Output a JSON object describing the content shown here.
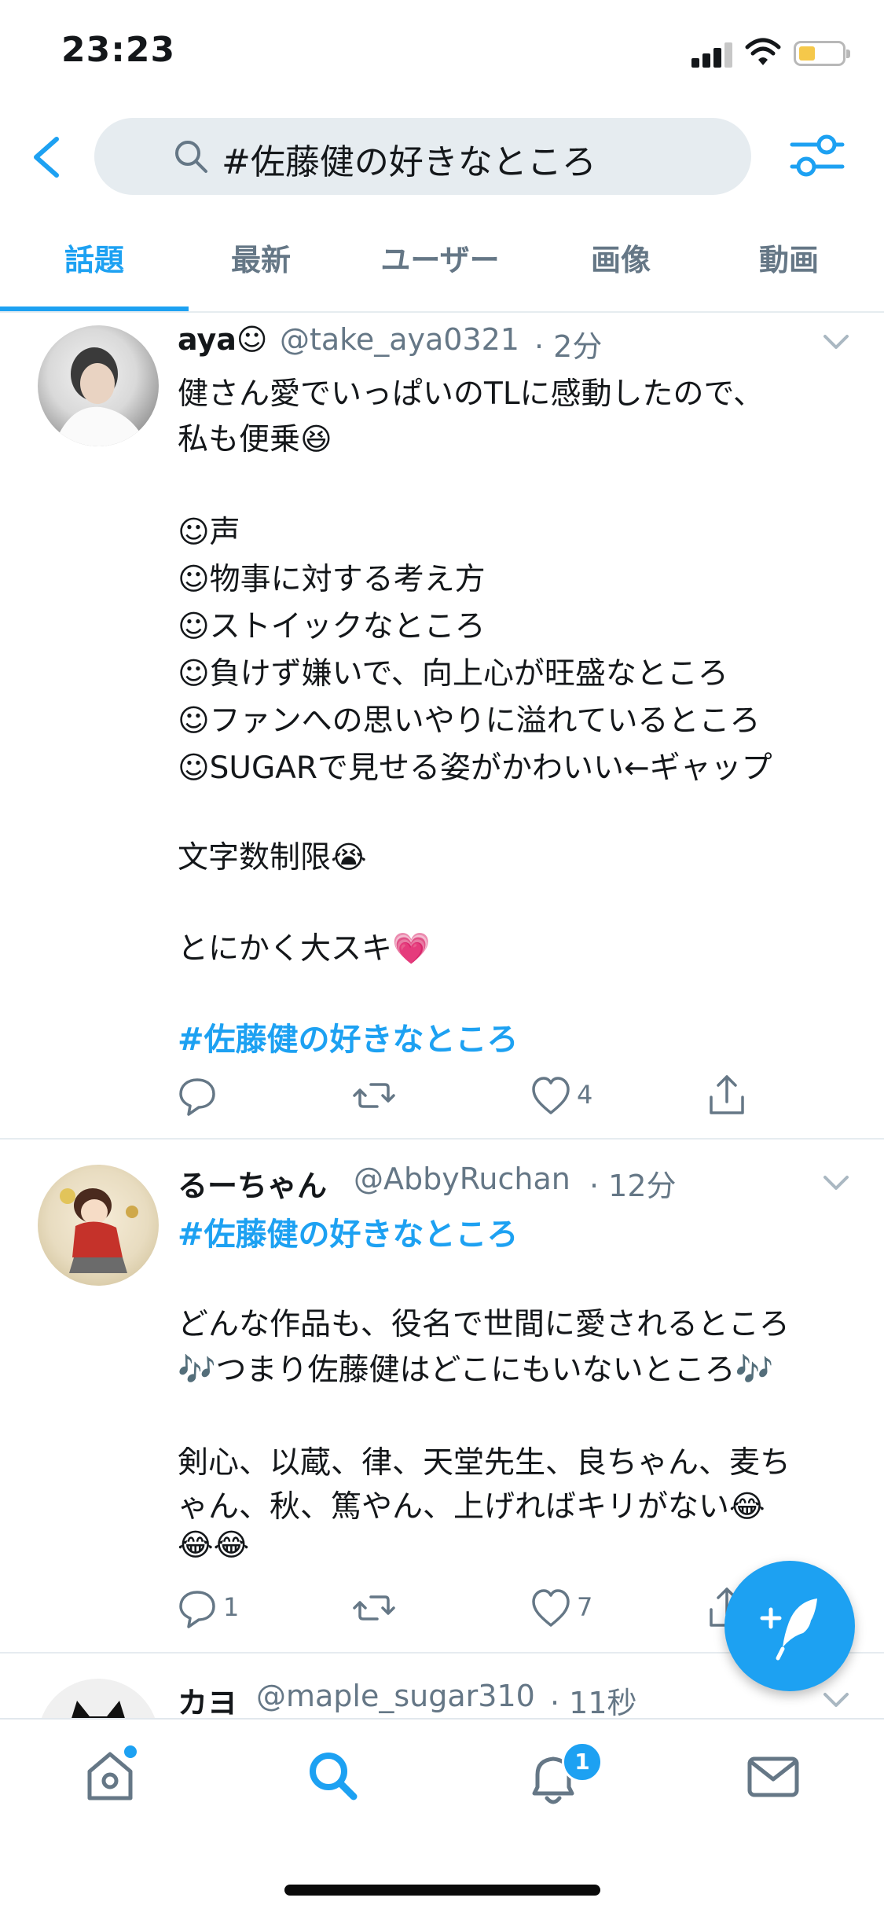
{
  "status_bar": {
    "time": "23:23"
  },
  "search": {
    "query": "#佐藤健の好きなところ"
  },
  "tabs": [
    {
      "label": "話題",
      "active": true
    },
    {
      "label": "最新",
      "active": false
    },
    {
      "label": "ユーザー",
      "active": false
    },
    {
      "label": "画像",
      "active": false
    },
    {
      "label": "動画",
      "active": false
    }
  ],
  "tweets": [
    {
      "name": "aya☺︎",
      "handle": "@take_aya0321",
      "time": "· 2分",
      "lines": [
        "健さん愛でいっぱいのTLに感動したので、",
        "私も便乗😆",
        "",
        "☺︎声",
        "☺︎物事に対する考え方",
        "☺︎ストイックなところ",
        "☺︎負けず嫌いで、向上心が旺盛なところ",
        "☺︎ファンへの思いやりに溢れているところ",
        "☺︎SUGARで見せる姿がかわいい←ギャップ",
        "",
        "文字数制限😭",
        "",
        "とにかく大スキ💗"
      ],
      "hashtag": "#佐藤健の好きなところ",
      "replies": "",
      "retweets": "",
      "likes": "4"
    },
    {
      "name": "るーちゃん",
      "handle": "@AbbyRuchan",
      "time": "· 12分",
      "hashtag": "#佐藤健の好きなところ",
      "lines": [
        "どんな作品も、役名で世間に愛されるところ",
        "🎶つまり佐藤健はどこにもいないところ🎶",
        "",
        "剣心、以蔵、律、天堂先生、良ちゃん、麦ち",
        "ゃん、秋、篤やん、上げればキリがない😂",
        "😂😂"
      ],
      "replies": "1",
      "retweets": "",
      "likes": "7"
    },
    {
      "name": "カヨ",
      "handle": "@maple_sugar310",
      "time": "· 11秒"
    }
  ],
  "bottom_nav": {
    "notification_count": "1"
  },
  "colors": {
    "accent": "#1da1f2",
    "secondary_text": "#657786",
    "divider": "#e6ecf0"
  },
  "icons": [
    "back-arrow-icon",
    "search-icon",
    "filter-settings-icon",
    "chevron-down-icon",
    "reply-icon",
    "retweet-icon",
    "heart-icon",
    "share-icon",
    "compose-tweet-icon",
    "home-icon",
    "explore-search-icon",
    "notifications-bell-icon",
    "messages-envelope-icon"
  ]
}
